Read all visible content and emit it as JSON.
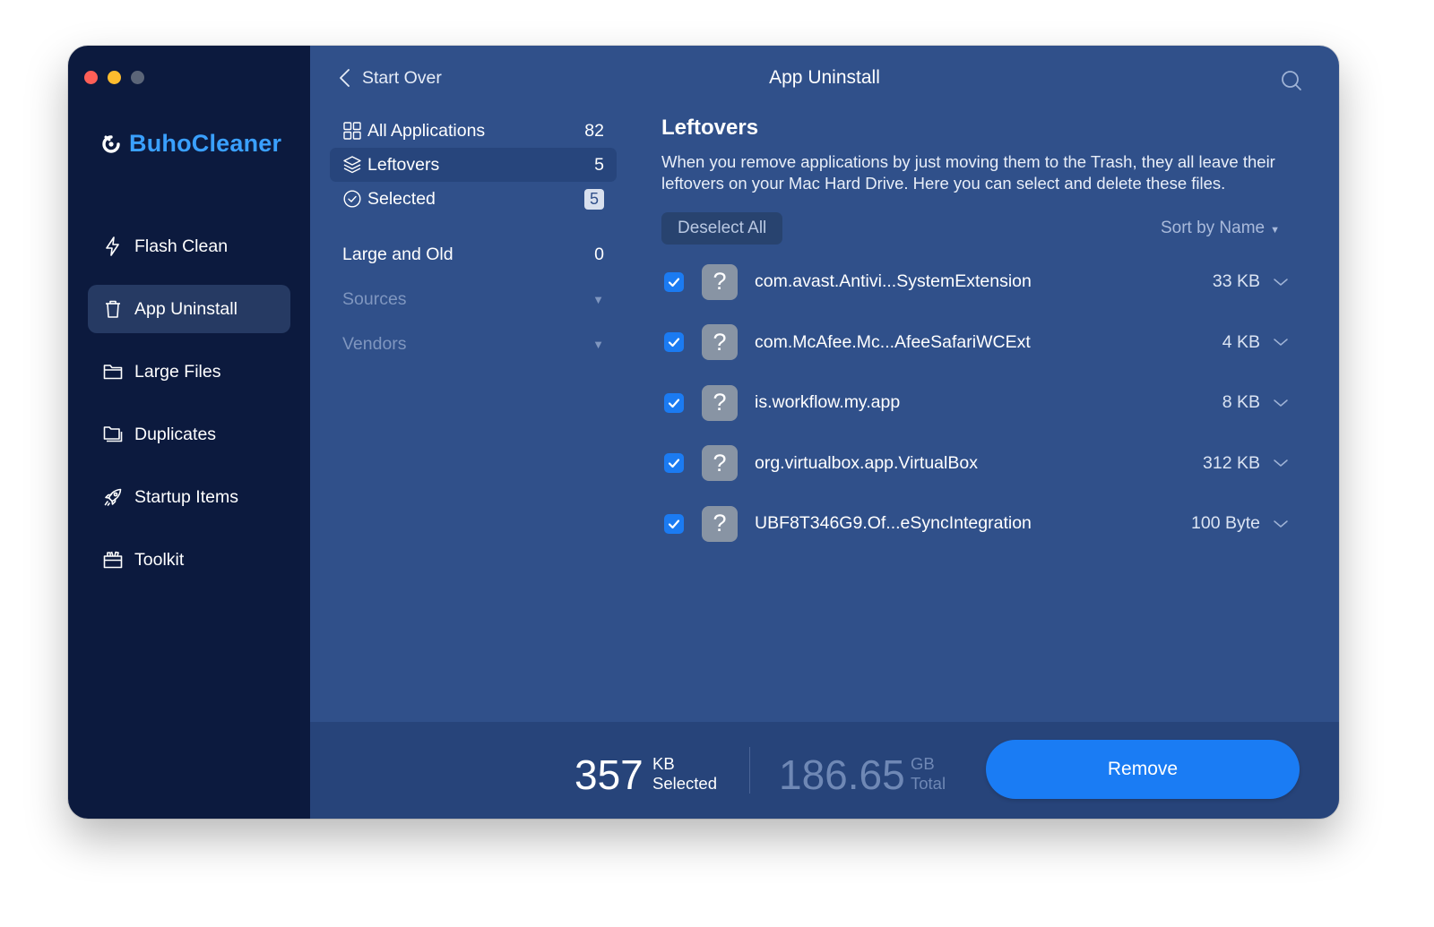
{
  "app": {
    "brand_name": "BuhoCleaner",
    "brand_color": "#3aa0ff",
    "accent_color": "#1a7cf4"
  },
  "sidebar": {
    "items": [
      {
        "label": "Flash Clean",
        "icon": "lightning-icon",
        "active": false
      },
      {
        "label": "App Uninstall",
        "icon": "trash-icon",
        "active": true
      },
      {
        "label": "Large Files",
        "icon": "folder-icon",
        "active": false
      },
      {
        "label": "Duplicates",
        "icon": "duplicate-folder-icon",
        "active": false
      },
      {
        "label": "Startup Items",
        "icon": "rocket-icon",
        "active": false
      },
      {
        "label": "Toolkit",
        "icon": "toolkit-icon",
        "active": false
      }
    ]
  },
  "header": {
    "back_label": "Start Over",
    "title": "App Uninstall",
    "search_icon": "search-icon"
  },
  "filters": {
    "all_applications": {
      "label": "All Applications",
      "count": "82"
    },
    "leftovers": {
      "label": "Leftovers",
      "count": "5"
    },
    "selected": {
      "label": "Selected",
      "count": "5"
    },
    "large_and_old": {
      "label": "Large and Old",
      "count": "0"
    },
    "sources": {
      "label": "Sources"
    },
    "vendors": {
      "label": "Vendors"
    }
  },
  "content": {
    "title": "Leftovers",
    "description": "When you remove applications by just moving them to the Trash, they all leave their leftovers on your Mac Hard Drive. Here you can select and delete these files.",
    "deselect_label": "Deselect All",
    "sort_label": "Sort by Name",
    "rows": [
      {
        "name": "com.avast.Antivi...SystemExtension",
        "size": "33 KB",
        "checked": true
      },
      {
        "name": "com.McAfee.Mc...AfeeSafariWCExt",
        "size": "4 KB",
        "checked": true
      },
      {
        "name": "is.workflow.my.app",
        "size": "8 KB",
        "checked": true
      },
      {
        "name": "org.virtualbox.app.VirtualBox",
        "size": "312 KB",
        "checked": true
      },
      {
        "name": "UBF8T346G9.Of...eSyncIntegration",
        "size": "100 Byte",
        "checked": true
      }
    ]
  },
  "footer": {
    "selected_value": "357",
    "selected_unit": "KB",
    "selected_label": "Selected",
    "total_value": "186.65",
    "total_unit": "GB",
    "total_label": "Total",
    "remove_label": "Remove"
  }
}
